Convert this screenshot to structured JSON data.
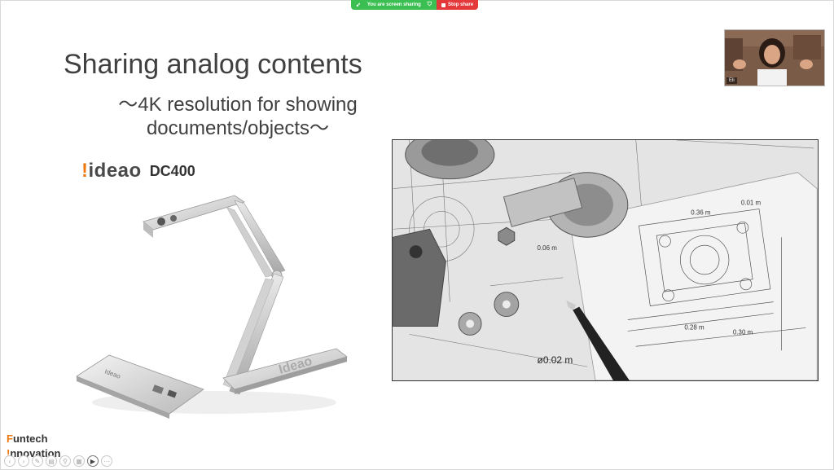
{
  "share_bar": {
    "status_text": "You are screen sharing",
    "stop_label": "Stop share"
  },
  "slide": {
    "title": "Sharing analog contents",
    "subtitle_line1": "～4K resolution for showing",
    "subtitle_line2": "documents/objects～",
    "brand_logo": "ideao",
    "model": "DC400",
    "product_label_stand": "Ideao",
    "drawing_label": "ø0.02 m",
    "footer_line1": "Funtech",
    "footer_line2": "Innovation"
  },
  "webcam": {
    "participant_name": "Eli"
  },
  "controls": [
    "back-icon",
    "forward-icon",
    "pen-icon",
    "highlighter-icon",
    "zoom-icon",
    "slides-icon",
    "camera-icon",
    "more-icon"
  ],
  "colors": {
    "accent_orange": "#f07a12",
    "share_green": "#3cbf52",
    "stop_red": "#e5383b",
    "title_gray": "#404040"
  }
}
